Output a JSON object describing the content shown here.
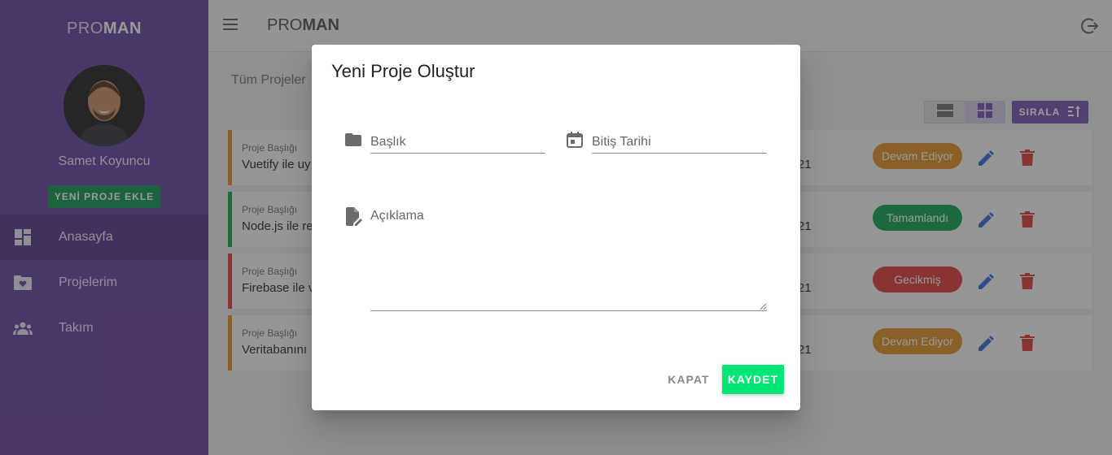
{
  "app": {
    "brand_light": "PRO",
    "brand_bold": "MAN"
  },
  "sidebar": {
    "user_name": "Samet Koyuncu",
    "new_project_label": "YENİ PROJE EKLE",
    "items": [
      {
        "label": "Anasayfa",
        "icon": "dashboard-icon",
        "active": true
      },
      {
        "label": "Projelerim",
        "icon": "folder-heart-icon",
        "active": false
      },
      {
        "label": "Takım",
        "icon": "people-icon",
        "active": false
      }
    ]
  },
  "header": {
    "title_light": "PRO",
    "title_bold": "MAN"
  },
  "main": {
    "breadcrumb": "Tüm Projeler",
    "sort_label": "SIRALA",
    "projects": [
      {
        "label": "Proje Başlığı",
        "title": "Vuetify ile uy",
        "date": "21",
        "status": "Devam Ediyor",
        "status_color": "#e2972f",
        "bar_color": "#e2972f"
      },
      {
        "label": "Proje Başlığı",
        "title": "Node.js ile re",
        "date": "21",
        "status": "Tamamlandı",
        "status_color": "#1aa958",
        "bar_color": "#1aa958"
      },
      {
        "label": "Proje Başlığı",
        "title": "Firebase ile v",
        "date": "21",
        "status": "Gecikmiş",
        "status_color": "#e04545",
        "bar_color": "#e04545"
      },
      {
        "label": "Proje Başlığı",
        "title": "Veritabanını",
        "date": "21",
        "status": "Devam Ediyor",
        "status_color": "#e2972f",
        "bar_color": "#e2972f"
      }
    ]
  },
  "dialog": {
    "title": "Yeni Proje Oluştur",
    "title_placeholder": "Başlık",
    "date_placeholder": "Bitiş Tarihi",
    "description_placeholder": "Açıklama",
    "close_label": "KAPAT",
    "save_label": "KAYDET"
  },
  "colors": {
    "sidebar": "#6e4aa6",
    "accent": "#00e676",
    "edit": "#3f6fd8",
    "delete": "#e04545"
  }
}
